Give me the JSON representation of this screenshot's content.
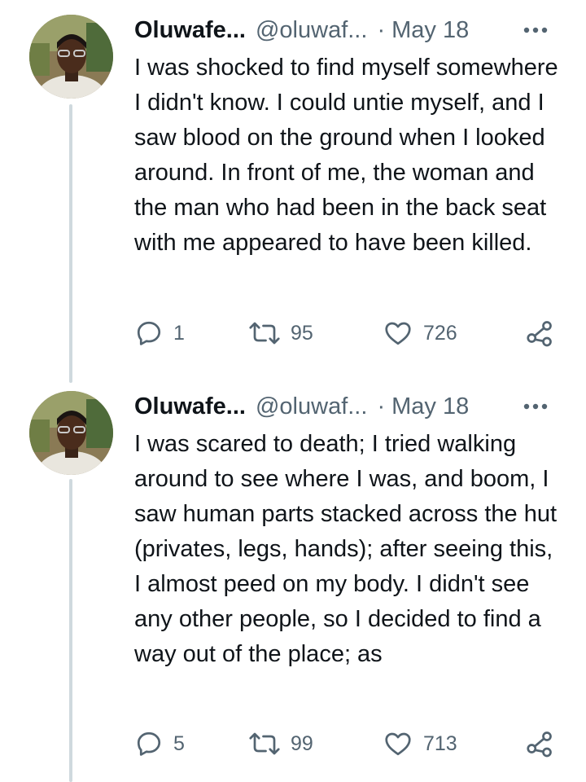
{
  "tweets": [
    {
      "author_name": "Oluwafe...",
      "handle": "@oluwaf...",
      "separator": "·",
      "date": "May 18",
      "text": "I was shocked to find myself somewhere I didn't know. I could untie myself, and I saw blood on the ground when I looked around. In front of me, the woman and the man who had been in the back seat with me appeared to have been killed.",
      "replies": "1",
      "retweets": "95",
      "likes": "726"
    },
    {
      "author_name": "Oluwafe...",
      "handle": "@oluwaf...",
      "separator": "·",
      "date": "May 18",
      "text": "I was scared to death; I tried walking around to see where I was, and boom, I saw human parts stacked across the hut (privates, legs, hands); after seeing this, I almost peed on my body. I didn't see any other people, so I decided to find a way out of the place; as",
      "replies": "5",
      "retweets": "99",
      "likes": "713"
    }
  ],
  "colors": {
    "text": "#0f1419",
    "secondary": "#536471",
    "thread_line": "#cfd9de"
  },
  "icons": [
    "reply-icon",
    "retweet-icon",
    "like-icon",
    "share-icon",
    "more-icon"
  ]
}
